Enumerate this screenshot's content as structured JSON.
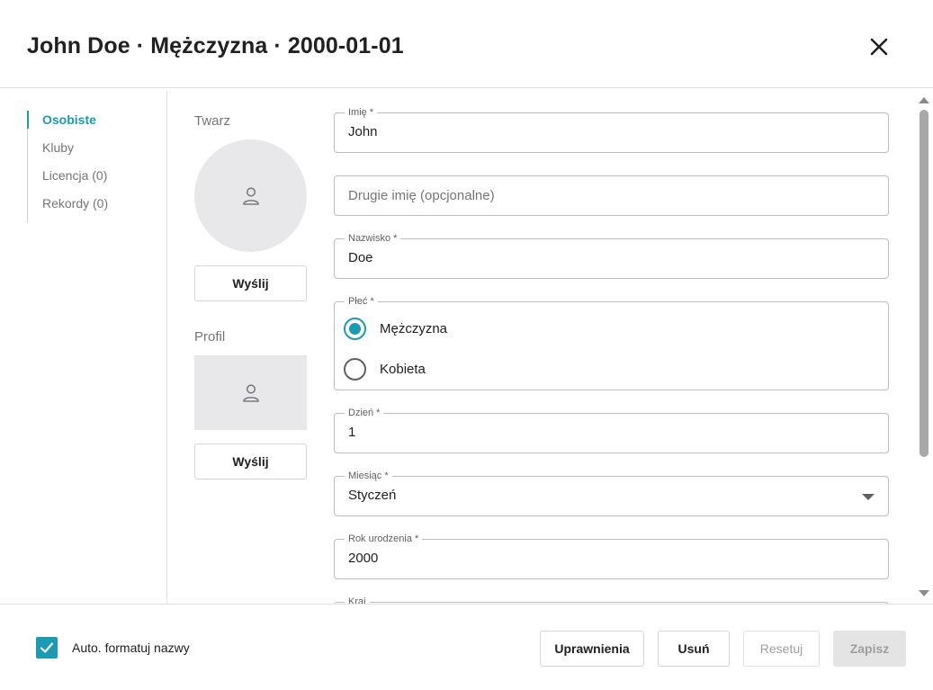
{
  "dialog": {
    "title": "John Doe · Mężczyzna · 2000-01-01",
    "close_icon": "close-icon"
  },
  "nav": {
    "items": [
      {
        "label": "Osobiste",
        "active": true
      },
      {
        "label": "Kluby",
        "active": false
      },
      {
        "label": "Licencja (0)",
        "active": false
      },
      {
        "label": "Rekordy (0)",
        "active": false
      }
    ]
  },
  "photos": {
    "face_label": "Twarz",
    "face_upload_label": "Wyślij",
    "profile_label": "Profil",
    "profile_upload_label": "Wyślij",
    "placeholder_icon": "person-icon"
  },
  "form": {
    "first_name": {
      "label": "Imię *",
      "value": "John"
    },
    "middle_name": {
      "placeholder": "Drugie imię (opcjonalne)",
      "value": ""
    },
    "last_name": {
      "label": "Nazwisko *",
      "value": "Doe"
    },
    "gender": {
      "label": "Płeć  *",
      "options": [
        {
          "label": "Mężczyzna",
          "checked": true
        },
        {
          "label": "Kobieta",
          "checked": false
        }
      ]
    },
    "day": {
      "label": "Dzień *",
      "value": "1"
    },
    "month": {
      "label": "Miesiąc *",
      "value": "Styczeń"
    },
    "year": {
      "label": "Rok urodzenia *",
      "value": "2000"
    },
    "country": {
      "label": "Kraj"
    }
  },
  "footer": {
    "auto_format_label": "Auto. formatuj nazwy",
    "auto_format_checked": true,
    "permissions_label": "Uprawnienia",
    "delete_label": "Usuń",
    "reset_label": "Resetuj",
    "save_label": "Zapisz"
  },
  "colors": {
    "accent": "#1a9bb3",
    "border": "#bdbdbd",
    "disabled_bg": "#e4e4e4"
  }
}
